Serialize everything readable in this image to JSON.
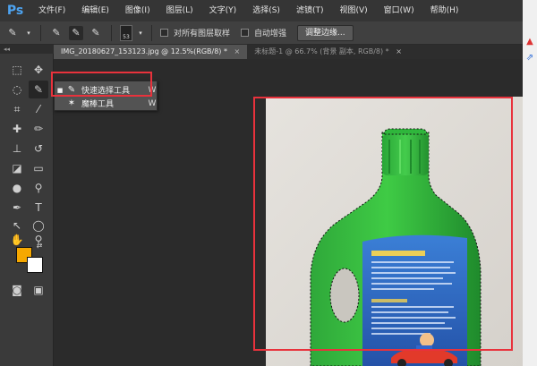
{
  "menubar": {
    "logo": "Ps",
    "items": [
      "文件(F)",
      "编辑(E)",
      "图像(I)",
      "图层(L)",
      "文字(Y)",
      "选择(S)",
      "滤镜(T)",
      "视图(V)",
      "窗口(W)",
      "帮助(H)"
    ]
  },
  "options": {
    "brush_size": "53",
    "sample_all_layers": "对所有图层取样",
    "auto_enhance": "自动增强",
    "refine_edge": "调整边缘..."
  },
  "tabs": [
    {
      "label": "IMG_20180627_153123.jpg @ 12.5%(RGB/8) *",
      "close": "×"
    },
    {
      "label": "未标题-1 @ 66.7% (背景 副本, RGB/8) *",
      "close": "×"
    }
  ],
  "toolbox_head": "◂◂",
  "flyout": {
    "items": [
      {
        "bullet": "■",
        "label": "快速选择工具",
        "key": "W"
      },
      {
        "bullet": "",
        "label": "魔棒工具",
        "key": "W"
      }
    ]
  },
  "colors": {
    "foreground": "#f6a800",
    "background": "#ffffff",
    "highlight": "#e8323c"
  }
}
